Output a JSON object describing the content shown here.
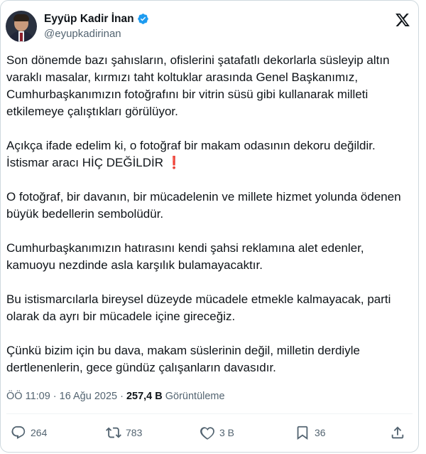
{
  "author": {
    "name": "Eyyüp Kadir İnan",
    "handle": "@eyupkadirinan",
    "verified_color": "#1d9bf0"
  },
  "tweet": {
    "paragraphs": [
      "Son dönemde bazı şahısların, ofislerini şatafatlı dekorlarla süsleyip altın varaklı masalar, kırmızı taht koltuklar arasında Genel Başkanımız, Cumhurbaşkanımızın fotoğrafını bir vitrin süsü gibi kullanarak milleti etkilemeye çalıştıkları görülüyor.",
      "Açıkça ifade edelim ki, o fotoğraf bir makam odasının dekoru değildir.",
      "O fotoğraf, bir davanın, bir mücadelenin ve millete hizmet yolunda ödenen büyük bedellerin sembolüdür.",
      "Cumhurbaşkanımızın hatırasını kendi şahsi reklamına alet edenler, kamuoyu nezdinde asla karşılık bulamayacaktır.",
      "Bu istismarcılarla bireysel düzeyde mücadele etmekle kalmayacak, parti olarak da ayrı bir mücadele içine gireceğiz.",
      "Çünkü bizim için bu dava, makam süslerinin değil, milletin derdiyle dertlenenlerin, gece gündüz çalışanların davasıdır."
    ],
    "line2b": "İstismar aracı HİÇ DEĞİLDİR",
    "emoji": "❗"
  },
  "meta": {
    "time": "ÖÖ 11:09",
    "separator": "·",
    "date": "16 Ağu 2025",
    "views_count": "257,4 B",
    "views_label": "Görüntüleme"
  },
  "actions": {
    "replies": "264",
    "reposts": "783",
    "likes": "3 B",
    "bookmarks": "36"
  },
  "icons": [
    "verified-badge-icon",
    "x-logo-icon",
    "reply-icon",
    "repost-icon",
    "like-icon",
    "bookmark-icon",
    "share-icon"
  ]
}
